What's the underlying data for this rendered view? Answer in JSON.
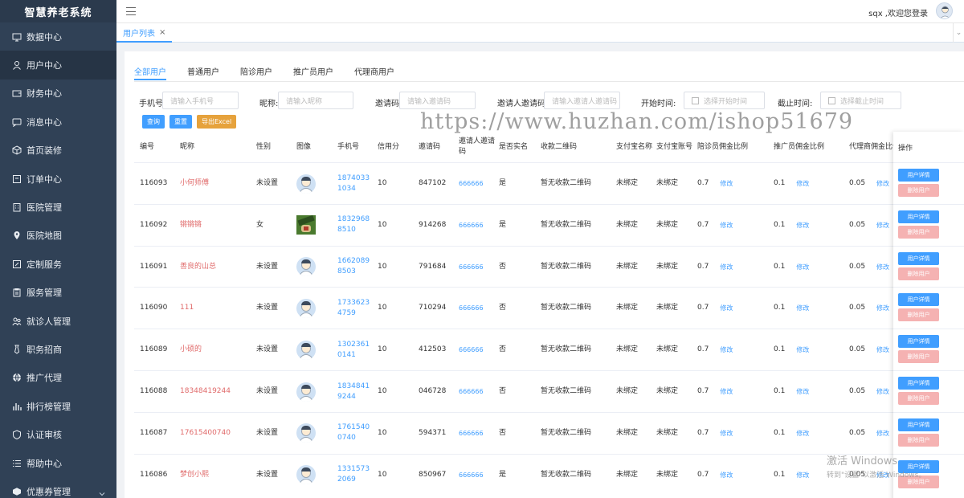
{
  "app": {
    "title": "智慧养老系统"
  },
  "sidebar": {
    "items": [
      {
        "label": "数据中心",
        "icon": "monitor-icon"
      },
      {
        "label": "用户中心",
        "icon": "user-icon",
        "active": true
      },
      {
        "label": "财务中心",
        "icon": "wallet-icon"
      },
      {
        "label": "消息中心",
        "icon": "message-icon"
      },
      {
        "label": "首页装修",
        "icon": "cube-icon"
      },
      {
        "label": "订单中心",
        "icon": "cart-icon"
      },
      {
        "label": "医院管理",
        "icon": "building-icon"
      },
      {
        "label": "医院地图",
        "icon": "map-pin-icon"
      },
      {
        "label": "定制服务",
        "icon": "edit-icon"
      },
      {
        "label": "服务管理",
        "icon": "clipboard-icon"
      },
      {
        "label": "就诊人管理",
        "icon": "people-icon"
      },
      {
        "label": "职务招商",
        "icon": "tie-icon"
      },
      {
        "label": "推广代理",
        "icon": "globe-icon"
      },
      {
        "label": "排行榜管理",
        "icon": "bar-chart-icon"
      },
      {
        "label": "认证审核",
        "icon": "shield-icon"
      },
      {
        "label": "帮助中心",
        "icon": "list-icon"
      },
      {
        "label": "优惠券管理",
        "icon": "ticket-icon",
        "has_submenu": true
      }
    ]
  },
  "header": {
    "welcome": "sqx ,欢迎您登录"
  },
  "tabs": [
    {
      "label": "用户列表",
      "close": "×"
    }
  ],
  "subtabs": [
    {
      "label": "全部用户",
      "active": true
    },
    {
      "label": "普通用户"
    },
    {
      "label": "陪诊用户"
    },
    {
      "label": "推广员用户"
    },
    {
      "label": "代理商用户"
    }
  ],
  "filters": {
    "phone": {
      "label": "手机号:",
      "placeholder": "请输入手机号"
    },
    "nickname": {
      "label": "昵称:",
      "placeholder": "请输入昵称"
    },
    "invite_code": {
      "label": "邀请码:",
      "placeholder": "请输入邀请码"
    },
    "inviter_code": {
      "label": "邀请人邀请码:",
      "placeholder": "请输入邀请人邀请码"
    },
    "start_time": {
      "label": "开始时间:",
      "placeholder": "选择开始时间"
    },
    "end_time": {
      "label": "截止时间:",
      "placeholder": "选择截止时间"
    }
  },
  "buttons": {
    "query": "查询",
    "reset": "重置",
    "export": "导出Excel"
  },
  "table": {
    "headers": {
      "id": "编号",
      "nickname": "昵称",
      "gender": "性别",
      "image": "图像",
      "phone": "手机号",
      "credit": "信用分",
      "invite_code": "邀请码",
      "inviter_code": "邀请人邀请码",
      "realname": "是否实名",
      "qrcode": "收款二维码",
      "alipay_name": "支付宝名称",
      "alipay_account": "支付宝账号",
      "escort_ratio": "陪诊员佣金比例",
      "promoter_ratio": "推广员佣金比例",
      "agent_ratio": "代理商佣金比例",
      "actions": "操作"
    },
    "edit_label": "修改",
    "detail_label": "用户详情",
    "delete_label": "删除用户",
    "rows": [
      {
        "id": "116093",
        "nickname": "小何师傅",
        "gender": "未设置",
        "image": "avatar",
        "phone": "18740331034",
        "credit": "10",
        "invite_code": "847102",
        "inviter_code": "666666",
        "realname": "是",
        "qrcode": "暂无收款二维码",
        "alipay_name": "未绑定",
        "alipay_account": "未绑定",
        "escort_ratio": "0.7",
        "promoter_ratio": "0.1",
        "agent_ratio": "0.05"
      },
      {
        "id": "116092",
        "nickname": "锵锵锵",
        "gender": "女",
        "image": "photo",
        "phone": "18329688510",
        "credit": "10",
        "invite_code": "914268",
        "inviter_code": "666666",
        "realname": "是",
        "qrcode": "暂无收款二维码",
        "alipay_name": "未绑定",
        "alipay_account": "未绑定",
        "escort_ratio": "0.7",
        "promoter_ratio": "0.1",
        "agent_ratio": "0.05"
      },
      {
        "id": "116091",
        "nickname": "善良的山总",
        "gender": "未设置",
        "image": "avatar",
        "phone": "16620898503",
        "credit": "10",
        "invite_code": "791684",
        "inviter_code": "666666",
        "realname": "否",
        "qrcode": "暂无收款二维码",
        "alipay_name": "未绑定",
        "alipay_account": "未绑定",
        "escort_ratio": "0.7",
        "promoter_ratio": "0.1",
        "agent_ratio": "0.05"
      },
      {
        "id": "116090",
        "nickname": "111",
        "gender": "未设置",
        "image": "avatar",
        "phone": "17336234759",
        "credit": "10",
        "invite_code": "710294",
        "inviter_code": "666666",
        "realname": "否",
        "qrcode": "暂无收款二维码",
        "alipay_name": "未绑定",
        "alipay_account": "未绑定",
        "escort_ratio": "0.7",
        "promoter_ratio": "0.1",
        "agent_ratio": "0.05"
      },
      {
        "id": "116089",
        "nickname": "小硕的",
        "gender": "未设置",
        "image": "avatar",
        "phone": "13023610141",
        "credit": "10",
        "invite_code": "412503",
        "inviter_code": "666666",
        "realname": "否",
        "qrcode": "暂无收款二维码",
        "alipay_name": "未绑定",
        "alipay_account": "未绑定",
        "escort_ratio": "0.7",
        "promoter_ratio": "0.1",
        "agent_ratio": "0.05"
      },
      {
        "id": "116088",
        "nickname": "18348419244",
        "gender": "未设置",
        "image": "avatar",
        "phone": "18348419244",
        "credit": "10",
        "invite_code": "046728",
        "inviter_code": "666666",
        "realname": "否",
        "qrcode": "暂无收款二维码",
        "alipay_name": "未绑定",
        "alipay_account": "未绑定",
        "escort_ratio": "0.7",
        "promoter_ratio": "0.1",
        "agent_ratio": "0.05"
      },
      {
        "id": "116087",
        "nickname": "17615400740",
        "gender": "未设置",
        "image": "avatar",
        "phone": "17615400740",
        "credit": "10",
        "invite_code": "594371",
        "inviter_code": "666666",
        "realname": "否",
        "qrcode": "暂无收款二维码",
        "alipay_name": "未绑定",
        "alipay_account": "未绑定",
        "escort_ratio": "0.7",
        "promoter_ratio": "0.1",
        "agent_ratio": "0.05"
      },
      {
        "id": "116086",
        "nickname": "梦创小熙",
        "gender": "未设置",
        "image": "avatar",
        "phone": "13315732069",
        "credit": "10",
        "invite_code": "850967",
        "inviter_code": "666666",
        "realname": "是",
        "qrcode": "暂无收款二维码",
        "alipay_name": "未绑定",
        "alipay_account": "未绑定",
        "escort_ratio": "0.7",
        "promoter_ratio": "0.1",
        "agent_ratio": "0.05"
      }
    ]
  },
  "overlay": {
    "watermark": "https://www.huzhan.com/ishop51679",
    "activate_title": "激活 Windows",
    "activate_sub": "转到\"设置\"以激活 Windows。"
  },
  "colors": {
    "sidebar_bg": "#304156",
    "primary": "#409eff",
    "warning": "#e6a23c",
    "danger_light": "#f5b2b2",
    "pink_text": "#e06b6b"
  }
}
